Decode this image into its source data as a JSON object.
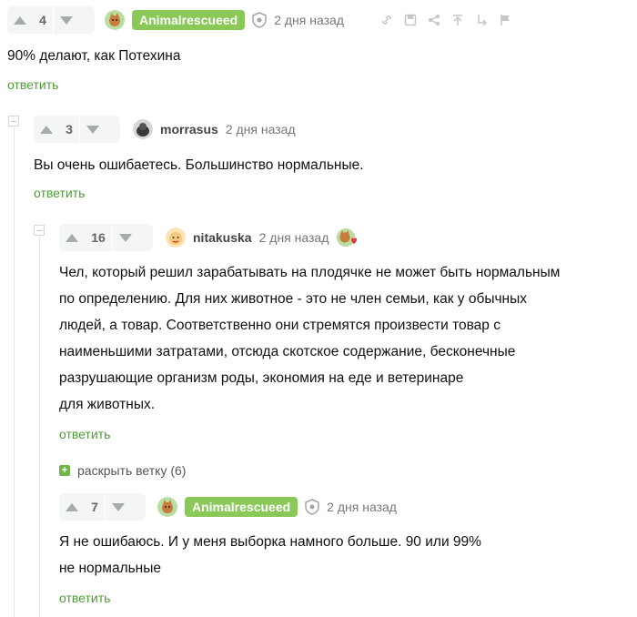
{
  "comments": [
    {
      "votes": "4",
      "author": "Animalrescueed",
      "time": "2 дня назад",
      "text": "90% делают, как Потехина",
      "reply_label": "ответить"
    },
    {
      "votes": "3",
      "author": "morrasus",
      "time": "2 дня назад",
      "text": "Вы очень ошибаетесь. Большинство нормальные.",
      "reply_label": "ответить"
    },
    {
      "votes": "16",
      "author": "nitakuska",
      "time": "2 дня назад",
      "lines": [
        "Чел, который решил зарабатывать на плодячке не может быть нормальным",
        "по определению. Для них животное - это не член семьи, как у обычных",
        "людей, а товар. Соответственно они стремятся произвести товар с",
        "наименьшими затратами, отсюда скотское содержание, бесконечные",
        "разрушающие организм роды, экономия на еде и ветеринаре",
        "для животных."
      ],
      "reply_label": "ответить",
      "expand_label": "раскрыть ветку (6)"
    },
    {
      "votes": "7",
      "author": "Animalrescueed",
      "time": "2 дня назад",
      "lines": [
        "Я не ошибаюсь. И у меня выборка намного больше. 90 или 99%",
        "не нормальные"
      ],
      "reply_label": "ответить"
    }
  ],
  "colors": {
    "accent_green": "#8ac858",
    "reply_green": "#4c9c36",
    "vote_bg": "#f4f5f5",
    "arrow": "#a6abab"
  }
}
